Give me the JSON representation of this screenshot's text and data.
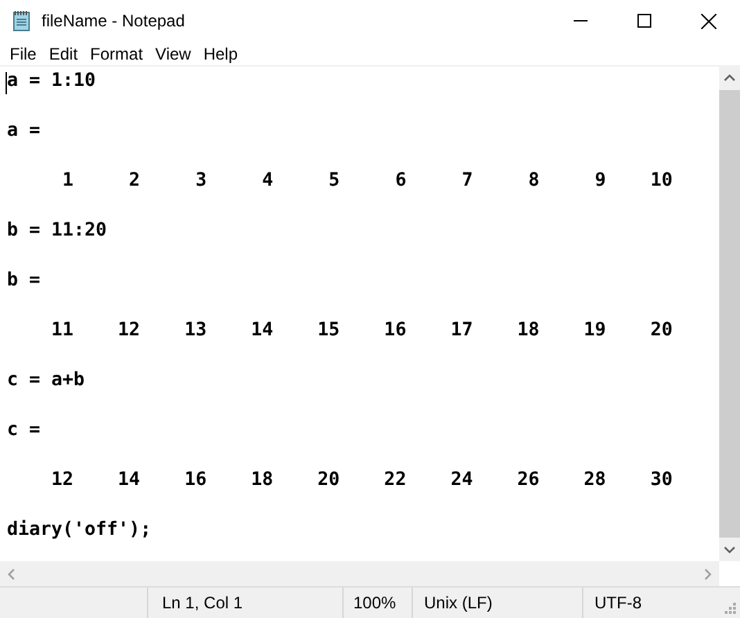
{
  "window": {
    "title": "fileName - Notepad"
  },
  "menu": [
    "File",
    "Edit",
    "Format",
    "View",
    "Help"
  ],
  "editor": {
    "lines": [
      "a = 1:10",
      "a =",
      "     1     2     3     4     5     6     7     8     9    10",
      "b = 11:20",
      "b =",
      "    11    12    13    14    15    16    17    18    19    20",
      "c = a+b",
      "c =",
      "    12    14    16    18    20    22    24    26    28    30",
      "diary('off');"
    ]
  },
  "status_bar": {
    "position": "Ln 1, Col 1",
    "zoom": "100%",
    "line_endings": "Unix (LF)",
    "encoding": "UTF-8"
  }
}
